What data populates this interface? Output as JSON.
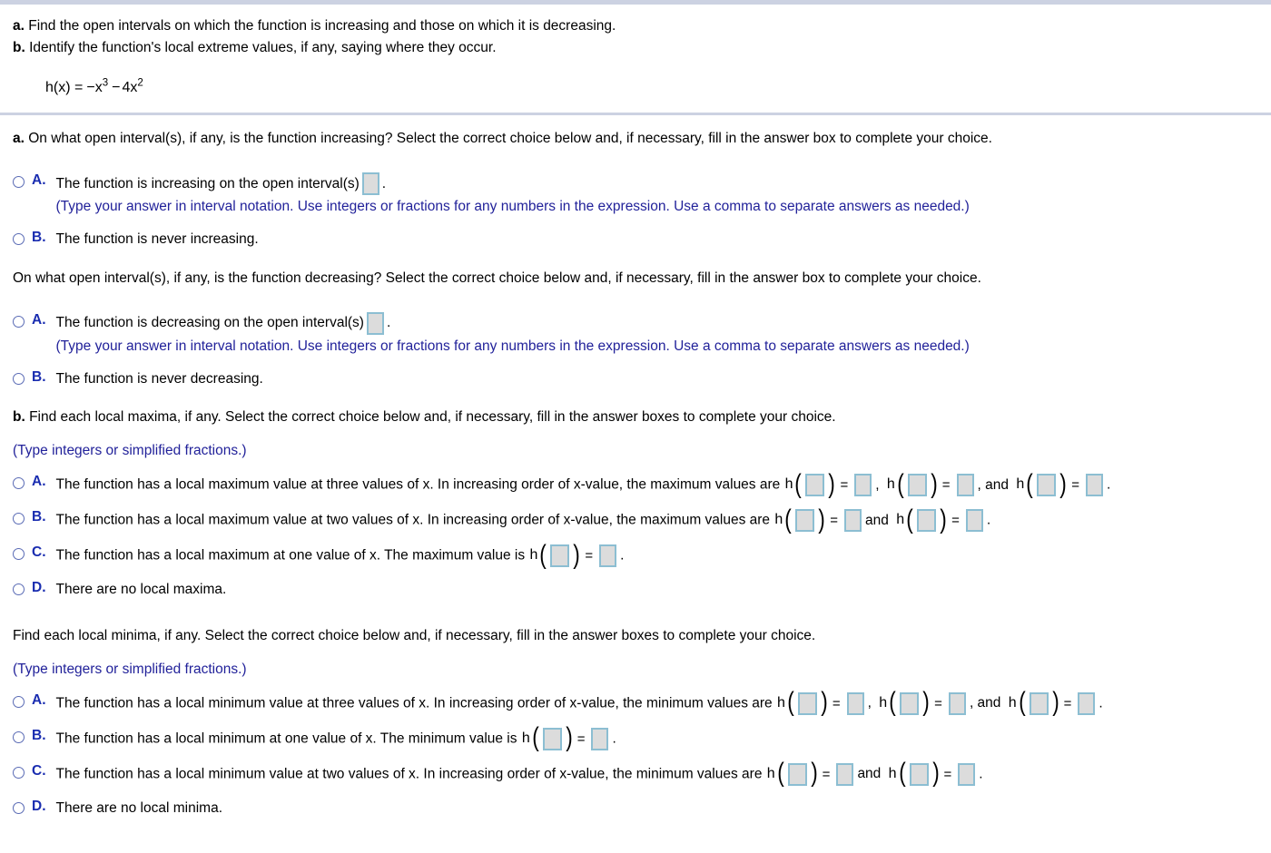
{
  "top": {
    "instructions": [
      {
        "label": "a.",
        "text": "Find the open intervals on which the function is increasing and those on which it is decreasing."
      },
      {
        "label": "b.",
        "text": "Identify the function's local extreme values, if any, saying where they occur."
      }
    ],
    "formula": {
      "lhs": "h(x) =",
      "term1_sign": "−",
      "term1_base": "x",
      "term1_exp": "3",
      "term2_sign": "−",
      "term2_coeff": "4x",
      "term2_exp": "2"
    }
  },
  "sections": {
    "increasing": {
      "label": "a.",
      "question": "On what open interval(s), if any, is the function increasing? Select the correct choice below and, if necessary, fill in the answer box to complete your choice.",
      "choices": [
        {
          "letter": "A.",
          "text_before": "The function is increasing on the open interval(s)",
          "text_after": ".",
          "hint": "(Type your answer in interval notation. Use integers or fractions for any numbers in the expression. Use a comma to separate answers as needed.)"
        },
        {
          "letter": "B.",
          "text_before": "The function is never increasing.",
          "text_after": "",
          "hint": ""
        }
      ]
    },
    "decreasing": {
      "question": "On what open interval(s), if any, is the function decreasing? Select the correct choice below and, if necessary, fill in the answer box to complete your choice.",
      "choices": [
        {
          "letter": "A.",
          "text_before": "The function is decreasing on the open interval(s)",
          "text_after": ".",
          "hint": "(Type your answer in interval notation. Use integers or fractions for any numbers in the expression. Use a comma to separate answers as needed.)"
        },
        {
          "letter": "B.",
          "text_before": "The function is never decreasing.",
          "text_after": "",
          "hint": ""
        }
      ]
    },
    "maxima": {
      "label": "b.",
      "question": "Find each local maxima, if any. Select the correct choice below and, if necessary, fill in the answer boxes to complete your choice.",
      "hint": "(Type integers or simplified fractions.)",
      "choices": [
        {
          "letter": "A.",
          "text": "The function has a local maximum value at three values of x. In increasing order of x-value, the maximum values are",
          "exprs": 3,
          "separators": [
            ",",
            ", and"
          ],
          "trailing": "."
        },
        {
          "letter": "B.",
          "text": "The function has a local maximum value at two values of x. In increasing order of x-value, the maximum values are",
          "exprs": 2,
          "separators": [
            "and"
          ],
          "trailing": "."
        },
        {
          "letter": "C.",
          "text": "The function has a local maximum at one value of x. The maximum value is",
          "exprs": 1,
          "separators": [],
          "trailing": "."
        },
        {
          "letter": "D.",
          "text": "There are no local maxima.",
          "exprs": 0,
          "separators": [],
          "trailing": ""
        }
      ]
    },
    "minima": {
      "question": "Find each local minima, if any. Select the correct choice below and, if necessary, fill in the answer boxes to complete your choice.",
      "hint": "(Type integers or simplified fractions.)",
      "choices": [
        {
          "letter": "A.",
          "text": "The function has a local minimum value at three values of x. In increasing order of x-value, the minimum values are",
          "exprs": 3,
          "separators": [
            ",",
            ", and"
          ],
          "trailing": "."
        },
        {
          "letter": "B.",
          "text": "The function has a local minimum at one value of x. The minimum value is",
          "exprs": 1,
          "separators": [],
          "trailing": "."
        },
        {
          "letter": "C.",
          "text": "The function has a local minimum value at two values of x. In increasing order of x-value, the minimum values are",
          "exprs": 2,
          "separators": [
            "and"
          ],
          "trailing": "."
        },
        {
          "letter": "D.",
          "text": "There are no local minima.",
          "exprs": 0,
          "separators": [],
          "trailing": ""
        }
      ]
    }
  },
  "glyphs": {
    "h_var": "h",
    "paren_open": "(",
    "paren_close": ")",
    "equals": "="
  },
  "colors": {
    "hint_blue": "#22229a",
    "letter_blue": "#1a2db0",
    "radio_border": "#5a6bb5",
    "box_border": "#8cbed2",
    "box_fill": "#dcdcdc",
    "divider": "#ccd2e2"
  }
}
